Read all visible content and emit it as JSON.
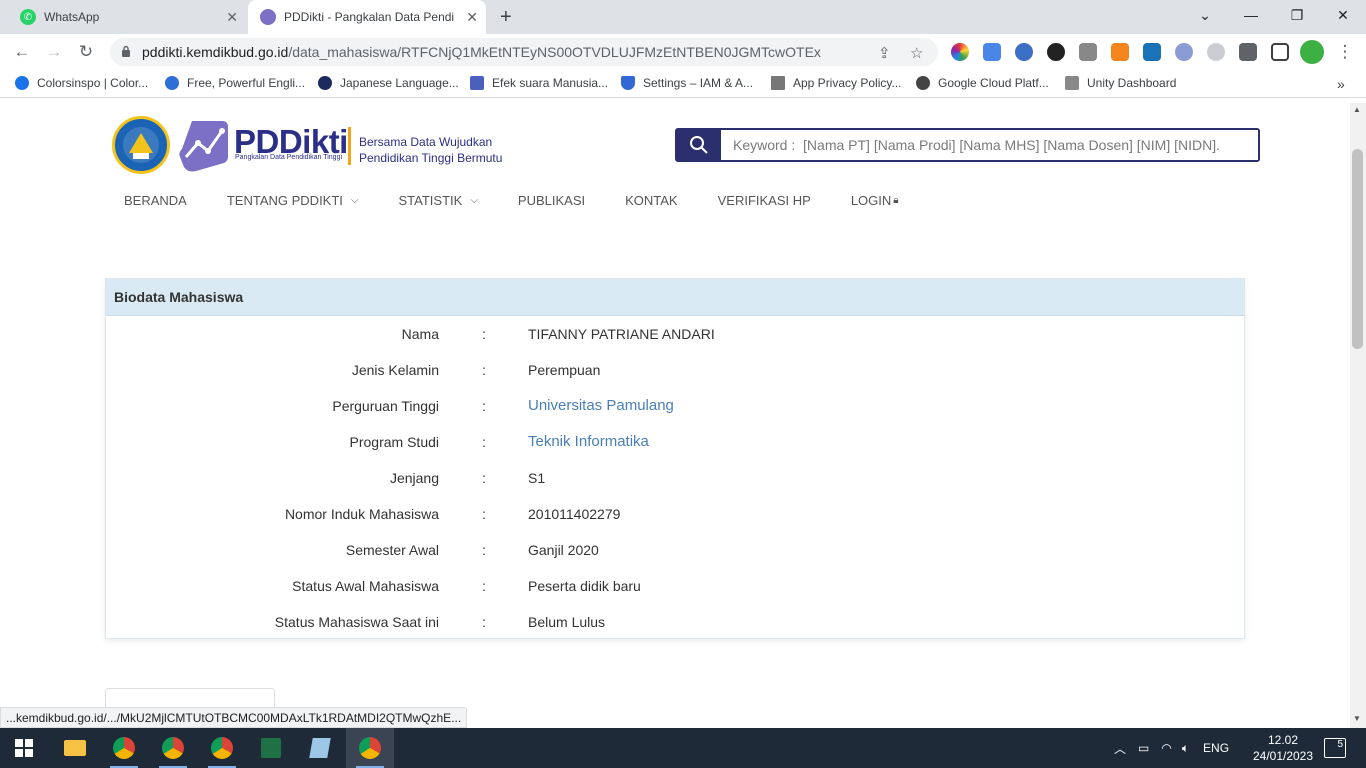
{
  "browser": {
    "tabs": [
      {
        "title": "WhatsApp",
        "active": false
      },
      {
        "title": "PDDikti - Pangkalan Data Pendidikan Tinggi",
        "active": true
      }
    ],
    "url_host": "pddikti.kemdikbud.go.id",
    "url_path": "/data_mahasiswa/RTFCNjQ1MkEtNTEyNS00OTVDLUJFMzEtNTBEN0JGMTcwOTEx",
    "bookmarks": [
      "Colorsinspo | Color...",
      "Free, Powerful Engli...",
      "Japanese Language...",
      "Efek suara Manusia...",
      "Settings – IAM & A...",
      "App Privacy Policy...",
      "Google Cloud Platf...",
      "Unity Dashboard"
    ],
    "status_url": "...kemdikbud.go.id/.../MkU2MjlCMTUtOTBCMC00MDAxLTk1RDAtMDI2QTMwQzhE..."
  },
  "site": {
    "logo_text": "PDDikti",
    "logo_sub": "Pangkalan Data Pendidikan Tinggi",
    "tagline_1": "Bersama Data Wujudkan",
    "tagline_2": "Pendidikan Tinggi Bermutu",
    "search_placeholder": "Keyword :  [Nama PT] [Nama Prodi] [Nama MHS] [Nama Dosen] [NIM] [NIDN].",
    "nav": [
      "BERANDA",
      "TENTANG PDDIKTI",
      "STATISTIK",
      "PUBLIKASI",
      "KONTAK",
      "VERIFIKASI HP",
      "LOGIN"
    ]
  },
  "biodata": {
    "title": "Biodata Mahasiswa",
    "rows": [
      {
        "label": "Nama",
        "value": "TIFANNY PATRIANE ANDARI",
        "link": false
      },
      {
        "label": "Jenis Kelamin",
        "value": "Perempuan",
        "link": false
      },
      {
        "label": "Perguruan Tinggi",
        "value": "Universitas Pamulang",
        "link": true
      },
      {
        "label": "Program Studi",
        "value": "Teknik Informatika",
        "link": true
      },
      {
        "label": "Jenjang",
        "value": "S1",
        "link": false
      },
      {
        "label": "Nomor Induk Mahasiswa",
        "value": "201011402279",
        "link": false
      },
      {
        "label": "Semester Awal",
        "value": "Ganjil 2020",
        "link": false
      },
      {
        "label": "Status Awal Mahasiswa",
        "value": "Peserta didik baru",
        "link": false
      },
      {
        "label": "Status Mahasiswa Saat ini",
        "value": "Belum Lulus",
        "link": false
      }
    ],
    "separator": ":"
  },
  "taskbar": {
    "language": "ENG",
    "time": "12.02",
    "date": "24/01/2023",
    "notifications": "5"
  }
}
